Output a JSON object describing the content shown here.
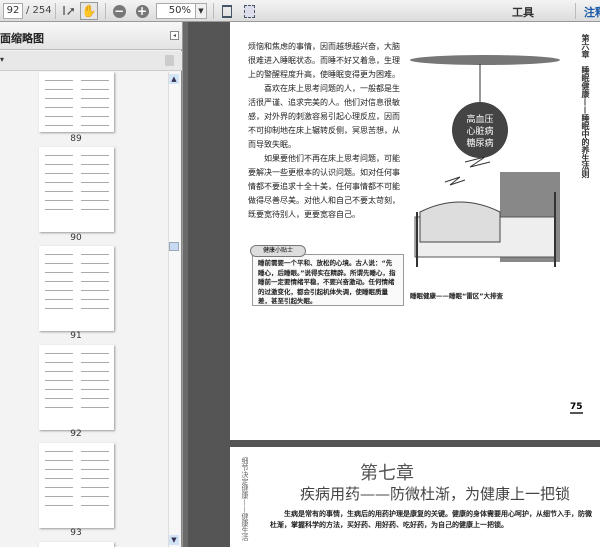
{
  "toolbar": {
    "page_current": "92",
    "page_total": "/ 254",
    "zoom_value": "50%",
    "tools_label": "工具",
    "comment_label": "注释"
  },
  "sidebar": {
    "title": "页面缩略图",
    "options_label": "▾",
    "thumbnails": [
      {
        "label": "89"
      },
      {
        "label": "90"
      },
      {
        "label": "91"
      },
      {
        "label": "92"
      },
      {
        "label": "93"
      }
    ]
  },
  "page75": {
    "paragraphs": [
      "烦恼和焦虑的事情，因而越想越兴奋，大脑很难进入睡眠状态。而睡不好又着急，生理上的警醒程度升高，使睡眠变得更为困难。",
      "喜欢在床上思考问题的人，一般都是生活很严谨、追求完美的人。他们对信息很敏感，对外界的刺激容易引起心理反应，因而不可抑制地在床上辗转反侧，冥思苦想，从而导致失眠。",
      "如果要他们不再在床上思考问题，可能要解决一些更根本的认识问题。如对任何事情都不要追求十全十美，任何事情都不可能做得尽善尽美。对他人和自己不要太苛刻，既要宽待别人，更要宽容自己。"
    ],
    "tip_tag": "健康小贴士",
    "tip_text": "睡前需要一个平和、放松的心境。古人说：“先睡心，后睡眼。”说得实在精辟。所谓先睡心，指睡前一定要情绪平稳，不要兴奋激动。任何情绪的过激变化，都会引起机体失调，使睡眠质量差，甚至引起失眠。",
    "illustration_text": [
      "高血压",
      "心脏病",
      "糖尿病"
    ],
    "caption": "睡眠健康——睡眠“雷区”大排查",
    "running_head": "第六章　睡眠健康——睡眠中的养生法则",
    "page_number": "75"
  },
  "page76": {
    "running_head": "细节决定健康——健康生活",
    "chapter_number": "第七章",
    "chapter_title": "疾病用药——防微杜渐，为健康上一把锁",
    "intro": "生病是常有的事情，生病后的用药护理是康复的关键。健康的身体需要用心呵护，从细节入手，防微杜渐，掌握科学的方法，买好药、用好药、吃好药，为自己的健康上一把锁。"
  }
}
